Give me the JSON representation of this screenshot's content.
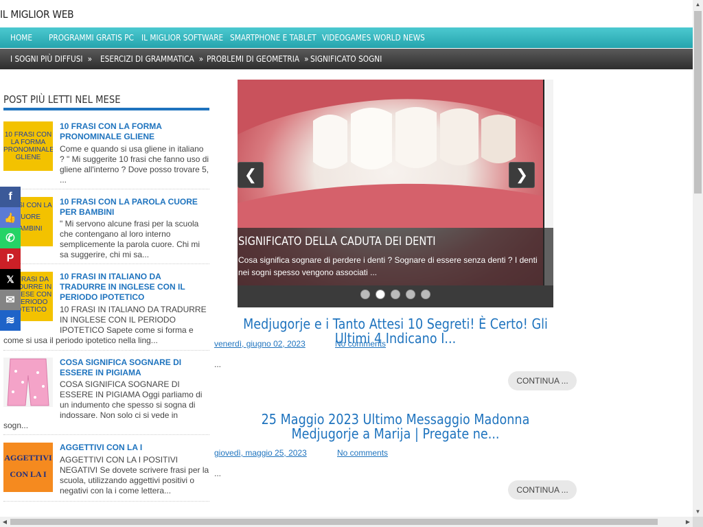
{
  "site": {
    "title": "IL MIGLIOR WEB"
  },
  "nav_primary": [
    "HOME",
    "PROGRAMMI GRATIS PC",
    "IL MIGLIOR SOFTWARE",
    "SMARTPHONE E TABLET",
    "VIDEOGAMES WORLD NEWS"
  ],
  "nav_secondary": [
    {
      "label": "I SOGNI PIÙ DIFFUSI",
      "chevron": "»"
    },
    {
      "label": "ESERCIZI DI GRAMMATICA",
      "chevron": "»"
    },
    {
      "label": "PROBLEMI DI GEOMETRIA",
      "chevron": "»"
    },
    {
      "label": "SIGNIFICATO SOGNI",
      "chevron": ""
    }
  ],
  "sidebar": {
    "widget_title": "POST PIÙ LETTI NEL MESE",
    "posts": [
      {
        "title": "10 FRASI CON LA FORMA PRONOMINALE GLIENE",
        "thumb_text": "10 FRASI CON LA FORMA PRONOMINALE GLIENE",
        "excerpt": "Come e quando si usa gliene in italiano ? \" Mi suggerite 10 frasi che fanno uso di gliene all'interno ? Dove posso trovare 5, ..."
      },
      {
        "title": "10 FRASI CON LA PAROLA CUORE PER BAMBINI",
        "thumb_text": "FRASI CON LA CUORE BAMBINI",
        "excerpt": "\" Mi servono alcune frasi per la scuola che contengano al loro interno semplicemente la parola cuore. Chi mi sa suggerire, chi mi sa..."
      },
      {
        "title": "10 FRASI IN ITALIANO DA TRADURRE IN INGLESE CON IL PERIODO IPOTETICO",
        "thumb_text": "10 FRASI DA TRADURRE IN INGLESE CON IL PERIODO IPOTETICO",
        "excerpt_a": "10 FRASI IN ITALIANO DA TRADURRE IN INGLESE CON IL PERIODO IPOTETICO Sapete come si forma e",
        "excerpt_b": "come si usa il periodo ipotetico nella ling..."
      },
      {
        "title": "COSA SIGNIFICA SOGNARE DI ESSERE IN PIGIAMA",
        "thumb_text": "",
        "excerpt_a": "COSA SIGNIFICA SOGNARE DI ESSERE IN PIGIAMA Oggi parliamo di un indumento che spesso si sogna di indossare. Non solo ci si vede in",
        "excerpt_b": "sogn..."
      },
      {
        "title": "AGGETTIVI CON LA I",
        "thumb_text": "AGGETTIVI CON LA I",
        "excerpt": "AGGETTIVI CON LA I POSITIVI NEGATIVI Se dovete scrivere frasi per la scuola, utilizzando aggettivi positivi o negativi con la i come lettera..."
      }
    ]
  },
  "share_bar": [
    {
      "icon": "facebook-icon",
      "glyph": "f",
      "color": "#3b5998"
    },
    {
      "icon": "like-icon",
      "glyph": "👍",
      "color": "#5b7bd5"
    },
    {
      "icon": "whatsapp-icon",
      "glyph": "✆",
      "color": "#25d366"
    },
    {
      "icon": "pinterest-icon",
      "glyph": "P",
      "color": "#cb2027"
    },
    {
      "icon": "x-icon",
      "glyph": "𝕏",
      "color": "#000000"
    },
    {
      "icon": "email-icon",
      "glyph": "✉",
      "color": "#848484"
    },
    {
      "icon": "sumome-icon",
      "glyph": "≋",
      "color": "#1e63c8"
    }
  ],
  "slider": {
    "title": "SIGNIFICATO DELLA CADUTA DEI DENTI",
    "text": "Cosa significa sognare di perdere i denti ? Sognare di essere senza denti ? I denti nei sogni spesso vengono associati ...",
    "prev": "❮",
    "next": "❯",
    "dots": 5,
    "active_dot": 2
  },
  "posts": [
    {
      "title": "Medjugorje e i Tanto Attesi 10 Segreti! È Certo! Gli Ultimi 4 Indicano I...",
      "date": "venerdì, giugno 02, 2023",
      "comments": "No comments",
      "excerpt": "...",
      "read_more": "CONTINUA ..."
    },
    {
      "title": "25 Maggio 2023 Ultimo Messaggio Madonna Medjugorje a Marija | Pregate ne...",
      "date": "giovedì, maggio 25, 2023",
      "comments": "No comments",
      "excerpt": "...",
      "read_more": "CONTINUA ..."
    }
  ],
  "colors": {
    "nav_primary": "#25a4ad",
    "link": "#1e73be",
    "nav_secondary": "#2e2e2e"
  }
}
